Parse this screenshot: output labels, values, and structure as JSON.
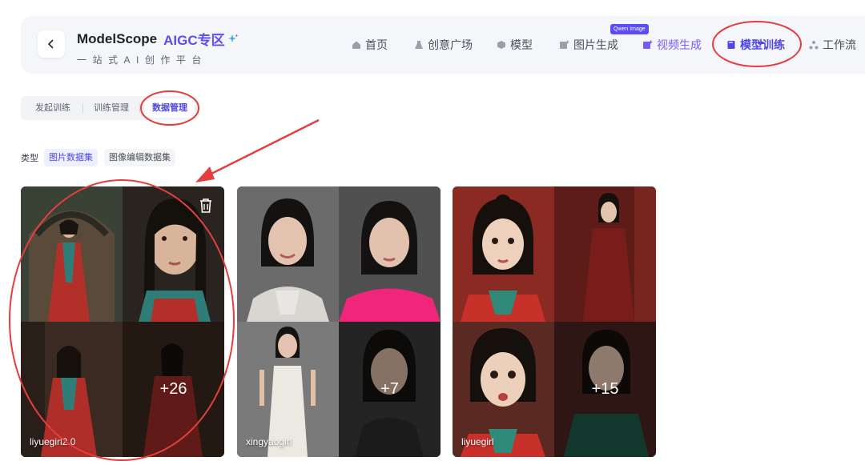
{
  "header": {
    "brand_name": "ModelScope",
    "brand_aigc": "AIGC专区",
    "brand_subtitle": "一站式AI创作平台",
    "nav": [
      {
        "label": "首页",
        "icon": "home-icon"
      },
      {
        "label": "创意广场",
        "icon": "flask-icon"
      },
      {
        "label": "模型",
        "icon": "cube-icon"
      },
      {
        "label": "图片生成",
        "icon": "image-plus-icon"
      },
      {
        "label": "视频生成",
        "icon": "video-plus-icon"
      },
      {
        "label": "模型训练",
        "icon": "book-icon",
        "active": true
      },
      {
        "label": "工作流",
        "icon": "workflow-icon"
      }
    ],
    "badge": "Qwen Image"
  },
  "subtabs": [
    {
      "label": "发起训练"
    },
    {
      "label": "训练管理"
    },
    {
      "label": "数据管理",
      "active": true
    }
  ],
  "type_filter": {
    "label": "类型",
    "options": [
      {
        "label": "图片数据集",
        "active": true
      },
      {
        "label": "图像编辑数据集"
      }
    ]
  },
  "datasets": [
    {
      "name": "liyuegirl2.0",
      "more_count": "+26"
    },
    {
      "name": "xingyaogirl",
      "more_count": "+7"
    },
    {
      "name": "liyuegirl",
      "more_count": "+15"
    }
  ],
  "colors": {
    "accent": "#4f46e5",
    "annotation": "#e53e3e"
  }
}
